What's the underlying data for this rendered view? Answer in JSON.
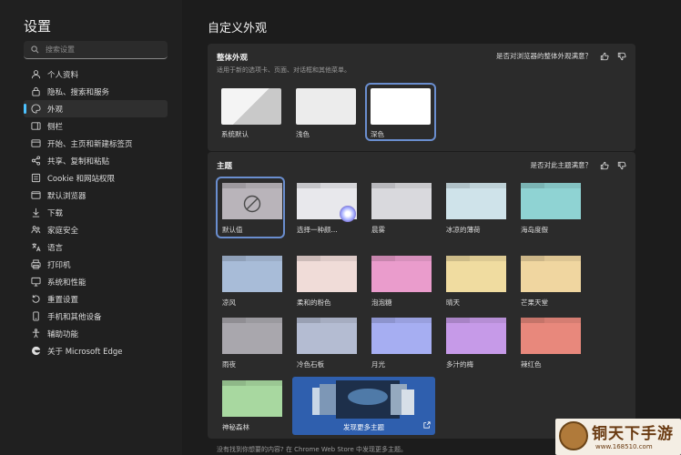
{
  "sidebar": {
    "title": "设置",
    "search_placeholder": "搜索设置",
    "items": [
      {
        "label": "个人资料",
        "icon": "profile-icon"
      },
      {
        "label": "隐私、搜索和服务",
        "icon": "lock-icon"
      },
      {
        "label": "外观",
        "icon": "palette-icon",
        "active": true
      },
      {
        "label": "侧栏",
        "icon": "sidebar-icon"
      },
      {
        "label": "开始、主页和新建标签页",
        "icon": "home-icon"
      },
      {
        "label": "共享、复制和粘贴",
        "icon": "share-icon"
      },
      {
        "label": "Cookie 和网站权限",
        "icon": "permissions-icon"
      },
      {
        "label": "默认浏览器",
        "icon": "browser-icon"
      },
      {
        "label": "下载",
        "icon": "download-icon"
      },
      {
        "label": "家庭安全",
        "icon": "family-icon"
      },
      {
        "label": "语言",
        "icon": "language-icon"
      },
      {
        "label": "打印机",
        "icon": "printer-icon"
      },
      {
        "label": "系统和性能",
        "icon": "system-icon"
      },
      {
        "label": "重置设置",
        "icon": "reset-icon"
      },
      {
        "label": "手机和其他设备",
        "icon": "phone-icon"
      },
      {
        "label": "辅助功能",
        "icon": "accessibility-icon"
      },
      {
        "label": "关于 Microsoft Edge",
        "icon": "edge-icon"
      }
    ]
  },
  "main": {
    "title": "自定义外观",
    "appearance": {
      "heading": "整体外观",
      "subtitle": "适用于新的选项卡、页面、对话框和其他菜单。",
      "feedback": "是否对浏览器的整体外观满意？",
      "modes": [
        {
          "label": "系统默认"
        },
        {
          "label": "浅色"
        },
        {
          "label": "深色",
          "selected": true
        }
      ]
    },
    "theme": {
      "heading": "主题",
      "feedback": "是否对此主题满意？",
      "tiles": [
        {
          "label": "默认值",
          "selected": true,
          "color": "#b9b4ba"
        },
        {
          "label": "选择一种颜...",
          "color": "#e8e8ec"
        },
        {
          "label": "晨雾",
          "color": "#d9d9dd"
        },
        {
          "label": "冰凉的薄荷",
          "color": "#cfe3ea"
        },
        {
          "label": "海岛度假",
          "color": "#8fd3d3"
        },
        {
          "label": "凉风",
          "color": "#a8bcd8"
        },
        {
          "label": "柔和的粉色",
          "color": "#f0dcd8"
        },
        {
          "label": "泡泡糖",
          "color": "#ea9ccc"
        },
        {
          "label": "晴天",
          "color": "#f0dca0"
        },
        {
          "label": "芒果天堂",
          "color": "#f0d6a0"
        },
        {
          "label": "雨夜",
          "color": "#a9a7ad"
        },
        {
          "label": "冷色石板",
          "color": "#b4bcd2"
        },
        {
          "label": "月光",
          "color": "#a6aef2"
        },
        {
          "label": "多汁的梅",
          "color": "#c69ae8"
        },
        {
          "label": "辣红色",
          "color": "#e8887c"
        },
        {
          "label": "神秘森林",
          "color": "#a8d8a0"
        }
      ],
      "store_tile_label": "发现更多主题",
      "footer": "没有找到你想要的内容? 在 Chrome Web Store 中发现更多主题。"
    }
  },
  "watermark": {
    "text": "铜天下手游",
    "url": "www.168510.com"
  },
  "colors": {
    "accent": "#4cc2ff",
    "selection": "#6a8ecf",
    "store_tile": "#2f5fae"
  }
}
